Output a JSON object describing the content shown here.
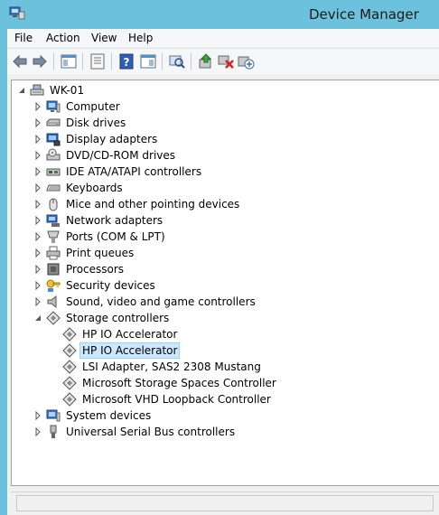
{
  "window": {
    "title": "Device Manager"
  },
  "menu": [
    "File",
    "Action",
    "View",
    "Help"
  ],
  "toolbar": [
    "back-icon",
    "forward-icon",
    "show-hide-console-tree-icon",
    "properties-icon",
    "help-icon",
    "action-pane-icon",
    "scan-hardware-icon",
    "update-driver-icon",
    "uninstall-device-icon",
    "add-legacy-hardware-icon"
  ],
  "tree": {
    "root": "WK-01",
    "categories": [
      {
        "label": "Computer",
        "icon": "computer-icon",
        "expanded": false
      },
      {
        "label": "Disk drives",
        "icon": "disk-drive-icon",
        "expanded": false
      },
      {
        "label": "Display adapters",
        "icon": "display-adapter-icon",
        "expanded": false
      },
      {
        "label": "DVD/CD-ROM drives",
        "icon": "dvd-drive-icon",
        "expanded": false
      },
      {
        "label": "IDE ATA/ATAPI controllers",
        "icon": "ide-controller-icon",
        "expanded": false
      },
      {
        "label": "Keyboards",
        "icon": "keyboard-icon",
        "expanded": false
      },
      {
        "label": "Mice and other pointing devices",
        "icon": "mouse-icon",
        "expanded": false
      },
      {
        "label": "Network adapters",
        "icon": "network-adapter-icon",
        "expanded": false
      },
      {
        "label": "Ports (COM & LPT)",
        "icon": "port-icon",
        "expanded": false
      },
      {
        "label": "Print queues",
        "icon": "printer-icon",
        "expanded": false
      },
      {
        "label": "Processors",
        "icon": "processor-icon",
        "expanded": false
      },
      {
        "label": "Security devices",
        "icon": "security-key-icon",
        "expanded": false
      },
      {
        "label": "Sound, video and game controllers",
        "icon": "speaker-icon",
        "expanded": false
      },
      {
        "label": "Storage controllers",
        "icon": "storage-controller-icon",
        "expanded": true,
        "children": [
          {
            "label": "HP IO Accelerator",
            "selected": false
          },
          {
            "label": "HP IO Accelerator",
            "selected": true
          },
          {
            "label": "LSI Adapter, SAS2 2308 Mustang",
            "selected": false
          },
          {
            "label": "Microsoft Storage Spaces Controller",
            "selected": false
          },
          {
            "label": "Microsoft VHD Loopback Controller",
            "selected": false
          }
        ]
      },
      {
        "label": "System devices",
        "icon": "system-devices-icon",
        "expanded": false
      },
      {
        "label": "Universal Serial Bus controllers",
        "icon": "usb-icon",
        "expanded": false
      }
    ]
  },
  "status": {
    "text": ""
  }
}
